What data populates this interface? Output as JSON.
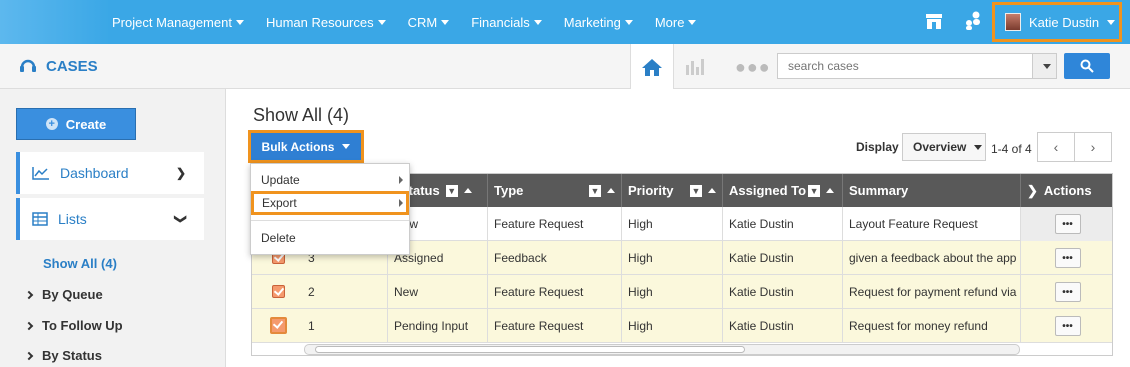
{
  "topnav": {
    "items": [
      {
        "label": "Project Management"
      },
      {
        "label": "Human Resources"
      },
      {
        "label": "CRM"
      },
      {
        "label": "Financials"
      },
      {
        "label": "Marketing"
      },
      {
        "label": "More"
      }
    ],
    "user_name": "Katie Dustin"
  },
  "module": {
    "title": "CASES"
  },
  "search": {
    "placeholder": "search cases"
  },
  "sidebar": {
    "create_label": "Create",
    "dashboard_label": "Dashboard",
    "lists_label": "Lists",
    "show_all_label": "Show All (4)",
    "sub_items": [
      {
        "label": "By Queue"
      },
      {
        "label": "To Follow Up"
      },
      {
        "label": "By Status"
      }
    ]
  },
  "main": {
    "title": "Show All (4)",
    "bulk_label": "Bulk Actions",
    "display_label": "Display",
    "display_value": "Overview",
    "pager_text": "1-4 of 4"
  },
  "bulk_menu": {
    "items": [
      {
        "label": "Update"
      },
      {
        "label": "Export"
      },
      {
        "label": "Delete"
      }
    ]
  },
  "table": {
    "headers": {
      "status": "Status",
      "type": "Type",
      "priority": "Priority",
      "assigned": "Assigned To",
      "summary": "Summary",
      "actions": "Actions"
    },
    "rows": [
      {
        "num": "",
        "status": "New",
        "type": "Feature Request",
        "priority": "High",
        "assigned": "Katie Dustin",
        "summary": "Layout Feature Request"
      },
      {
        "num": "3",
        "status": "Assigned",
        "type": "Feedback",
        "priority": "High",
        "assigned": "Katie Dustin",
        "summary": "given a feedback about the app"
      },
      {
        "num": "2",
        "status": "New",
        "type": "Feature Request",
        "priority": "High",
        "assigned": "Katie Dustin",
        "summary": "Request for payment refund via"
      },
      {
        "num": "1",
        "status": "Pending Input",
        "type": "Feature Request",
        "priority": "High",
        "assigned": "Katie Dustin",
        "summary": "Request for money refund"
      }
    ],
    "action_glyph": "•••"
  },
  "colors": {
    "topbar": "#3aa7e6",
    "accent": "#2f7fd3",
    "highlight": "#f0931e",
    "row_selected": "#fbf8dc"
  }
}
